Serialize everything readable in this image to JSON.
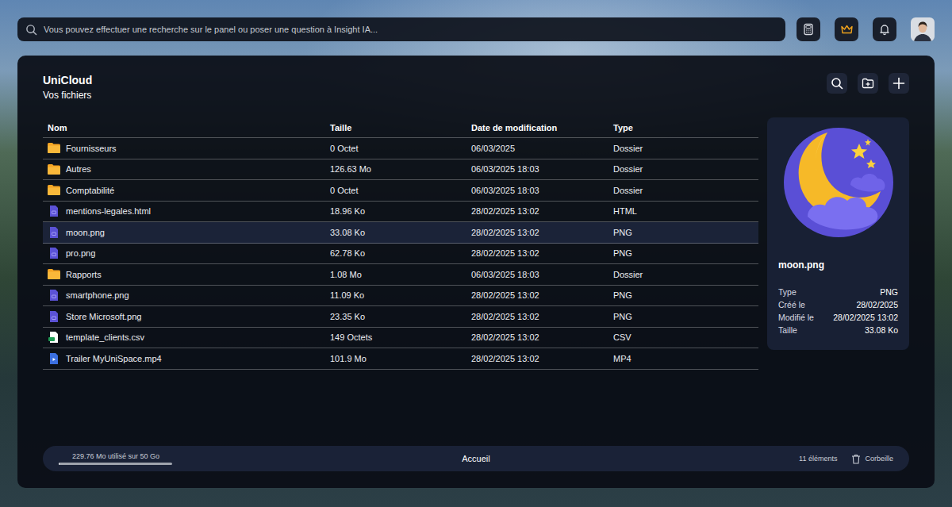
{
  "search": {
    "placeholder": "Vous pouvez effectuer une recherche sur le panel ou poser une question à Insight IA..."
  },
  "header": {
    "title": "UniCloud",
    "subtitle": "Vos fichiers"
  },
  "table": {
    "columns": [
      "Nom",
      "Taille",
      "Date de modification",
      "Type"
    ],
    "rows": [
      {
        "name": "Fournisseurs",
        "size": "0 Octet",
        "date": "06/03/2025",
        "type": "Dossier",
        "kind": "folder",
        "selected": false
      },
      {
        "name": "Autres",
        "size": "126.63 Mo",
        "date": "06/03/2025 18:03",
        "type": "Dossier",
        "kind": "folder",
        "selected": false
      },
      {
        "name": "Comptabilité",
        "size": "0 Octet",
        "date": "06/03/2025 18:03",
        "type": "Dossier",
        "kind": "folder",
        "selected": false
      },
      {
        "name": "mentions-legales.html",
        "size": "18.96 Ko",
        "date": "28/02/2025 13:02",
        "type": "HTML",
        "kind": "file",
        "selected": false
      },
      {
        "name": "moon.png",
        "size": "33.08 Ko",
        "date": "28/02/2025 13:02",
        "type": "PNG",
        "kind": "file",
        "selected": true
      },
      {
        "name": "pro.png",
        "size": "62.78 Ko",
        "date": "28/02/2025 13:02",
        "type": "PNG",
        "kind": "file",
        "selected": false
      },
      {
        "name": "Rapports",
        "size": "1.08 Mo",
        "date": "06/03/2025 18:03",
        "type": "Dossier",
        "kind": "folder",
        "selected": false
      },
      {
        "name": "smartphone.png",
        "size": "11.09 Ko",
        "date": "28/02/2025 13:02",
        "type": "PNG",
        "kind": "file",
        "selected": false
      },
      {
        "name": "Store Microsoft.png",
        "size": "23.35 Ko",
        "date": "28/02/2025 13:02",
        "type": "PNG",
        "kind": "file",
        "selected": false
      },
      {
        "name": "template_clients.csv",
        "size": "149 Octets",
        "date": "28/02/2025 13:02",
        "type": "CSV",
        "kind": "csv",
        "selected": false
      },
      {
        "name": "Trailer MyUniSpace.mp4",
        "size": "101.9 Mo",
        "date": "28/02/2025 13:02",
        "type": "MP4",
        "kind": "video",
        "selected": false
      }
    ]
  },
  "preview": {
    "name": "moon.png",
    "details": [
      {
        "label": "Type",
        "value": "PNG"
      },
      {
        "label": "Créé le",
        "value": "28/02/2025"
      },
      {
        "label": "Modifié le",
        "value": "28/02/2025 13:02"
      },
      {
        "label": "Taille",
        "value": "33.08 Ko"
      }
    ]
  },
  "footer": {
    "storage": "229.76 Mo utilisé sur 50 Go",
    "level": 0.0045,
    "location": "Accueil",
    "count": "11 éléments",
    "trash": "Corbeille"
  }
}
